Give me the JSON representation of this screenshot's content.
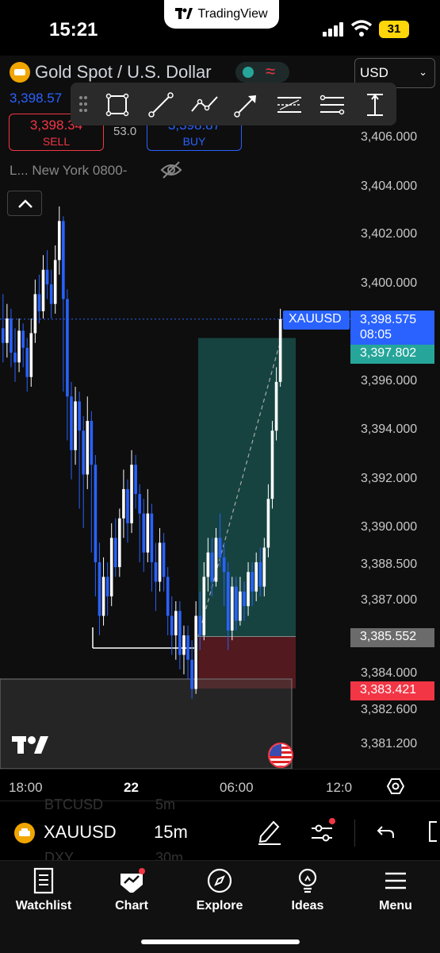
{
  "status": {
    "time": "15:21",
    "app_pill": "TradingView",
    "battery": "31"
  },
  "header": {
    "symbol_title": "Gold Spot / U.S. Dollar",
    "currency": "USD",
    "last_price": "3,398.57",
    "sell_price": "3,398.34",
    "sell_label": "SELL",
    "spread": "53.0",
    "buy_price": "3,398.87",
    "buy_label": "BUY",
    "session": "L... New York 0800-"
  },
  "toolbar": [
    "rectangle-tool-icon",
    "trend-line-tool-icon",
    "path-tool-icon",
    "arrow-tool-icon",
    "parallel-channel-tool-icon",
    "fib-tool-icon",
    "price-range-tool-icon"
  ],
  "price_axis": [
    "3,406.000",
    "3,404.000",
    "3,402.000",
    "3,400.000",
    "3,396.000",
    "3,394.000",
    "3,392.000",
    "3,390.000",
    "3,388.500",
    "3,387.000",
    "3,384.000",
    "3,382.600",
    "3,381.200"
  ],
  "tags": {
    "symbol": "XAUUSD",
    "current_price": "3,398.575",
    "countdown": "08:05",
    "target": "3,397.802",
    "entry": "3,385.552",
    "stop": "3,383.421"
  },
  "time_axis": [
    "18:00",
    "22",
    "06:00",
    "12:0"
  ],
  "chart_data": {
    "type": "candlestick",
    "y_axis_range": [
      3380.2,
      3407.2
    ],
    "current_price": 3398.575,
    "position": {
      "side": "long",
      "entry": 3385.552,
      "target": 3397.802,
      "stop": 3383.421
    },
    "up_color": "#ffffff",
    "down_color": "#2962ff"
  },
  "symbar": {
    "symbol": "XAUUSD",
    "interval": "15m",
    "ghost_symbol_1": "BTCUSD",
    "ghost_interval_1": "5m",
    "ghost_symbol_2": "DXY",
    "ghost_interval_2": "30m"
  },
  "nav": [
    {
      "label": "Watchlist",
      "icon": "watchlist-icon"
    },
    {
      "label": "Chart",
      "icon": "chart-icon"
    },
    {
      "label": "Explore",
      "icon": "compass-icon"
    },
    {
      "label": "Ideas",
      "icon": "lightbulb-icon"
    },
    {
      "label": "Menu",
      "icon": "hamburger-icon"
    }
  ],
  "colors": {
    "accent": "#2962ff",
    "sell": "#f23645",
    "profit": "#26a69a"
  }
}
